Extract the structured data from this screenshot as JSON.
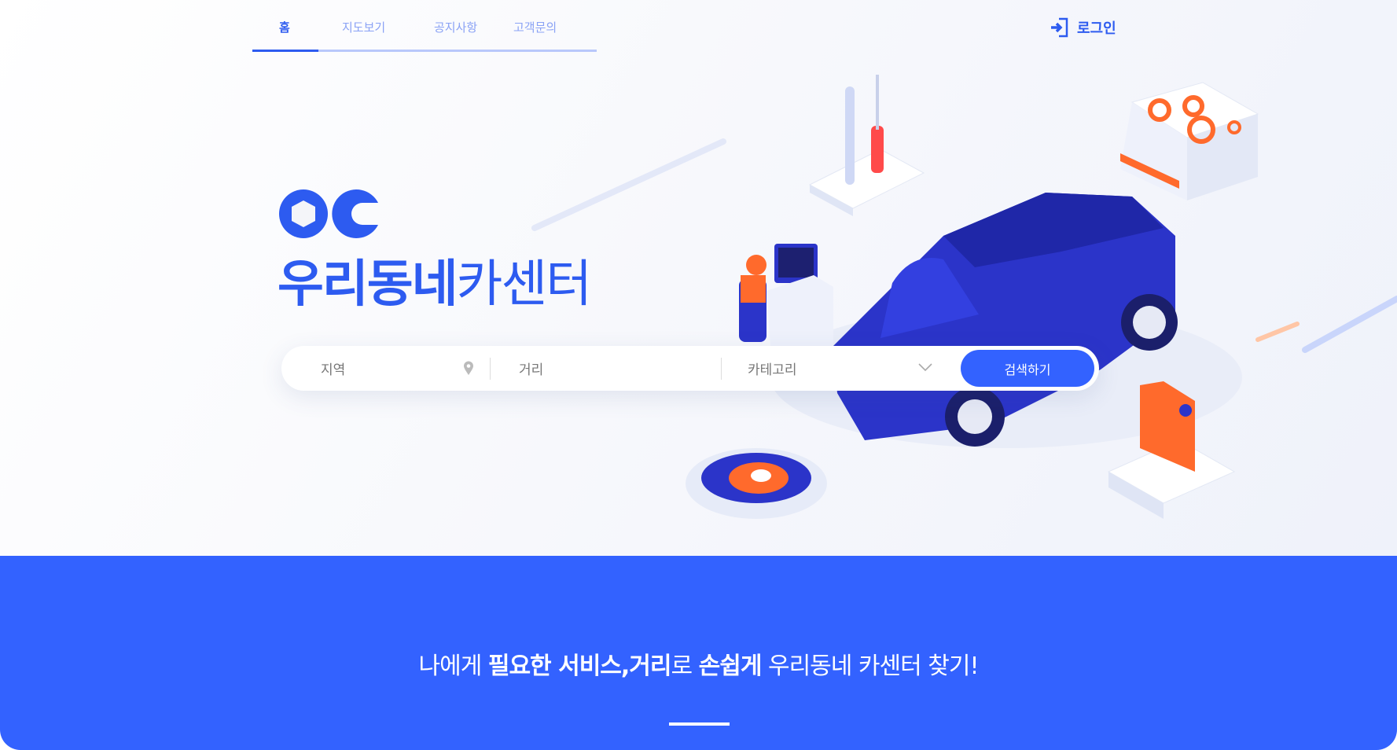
{
  "nav": {
    "tabs": [
      {
        "label": "홈",
        "active": true
      },
      {
        "label": "지도보기",
        "active": false
      },
      {
        "label": "공지사항",
        "active": false
      },
      {
        "label": "고객문의",
        "active": false
      }
    ],
    "login_label": "로그인",
    "login_icon": "sign-in-icon"
  },
  "hero": {
    "logo_text": "OC",
    "title_bold": "우리동네",
    "title_regular": "카센터"
  },
  "search": {
    "region_placeholder": "지역",
    "region_icon": "map-pin-icon",
    "distance_placeholder": "거리",
    "category_selected": "카테고리",
    "category_icon": "chevron-down-icon",
    "button_label": "검색하기"
  },
  "banner": {
    "tagline_parts": [
      {
        "text": "나에게 ",
        "bold": false
      },
      {
        "text": "필요한 서비스,거리",
        "bold": true
      },
      {
        "text": "로 ",
        "bold": false
      },
      {
        "text": "손쉽게",
        "bold": true
      },
      {
        "text": " 우리동네 카센터 찾기!",
        "bold": false
      }
    ]
  },
  "colors": {
    "primary": "#3362ff",
    "nav_inactive": "#8aa2f5",
    "accent_orange": "#ff6a2c"
  }
}
